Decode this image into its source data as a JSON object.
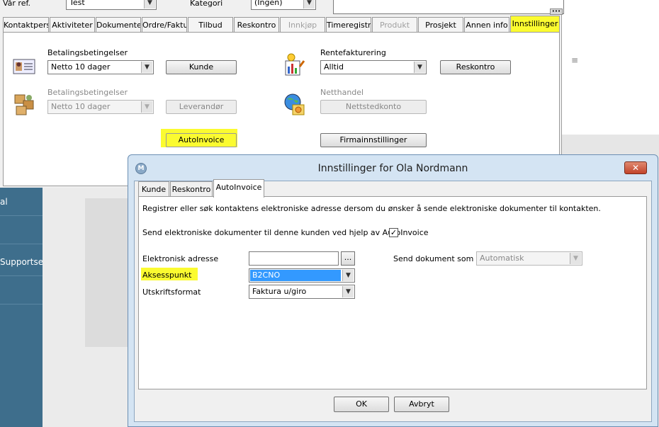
{
  "header": {
    "var_ref_label": "Vår ref.",
    "var_ref_value": "Test",
    "kategori_label": "Kategori",
    "kategori_value": "(Ingen)"
  },
  "tabs": [
    {
      "label": "Kontaktpersοn"
    },
    {
      "label": "Aktiviteter"
    },
    {
      "label": "Dokumenter"
    },
    {
      "label": "Ordre/Faktu"
    },
    {
      "label": "Tilbud"
    },
    {
      "label": "Reskontro"
    },
    {
      "label": "Innkjøp"
    },
    {
      "label": "Timeregistrer"
    },
    {
      "label": "Produkt"
    },
    {
      "label": "Prosjekt"
    },
    {
      "label": "Annen info"
    },
    {
      "label": "Innstillinger"
    }
  ],
  "settings": {
    "kunde_betaling_label": "Betalingsbetingelser",
    "kunde_betaling_value": "Netto 10 dager",
    "kunde_button": "Kunde",
    "lev_betaling_label": "Betalingsbetingelser",
    "lev_betaling_value": "Netto 10 dager",
    "lev_button": "Leverandør",
    "autoinvoice_button": "AutoInvoice",
    "rente_label": "Rentefakturering",
    "rente_value": "Alltid",
    "reskontro_button": "Reskontro",
    "netthandel_label": "Netthandel",
    "nettsted_button": "Nettstedkonto",
    "firma_button": "Firmainnstillinger"
  },
  "sidebar": {
    "items": [
      {
        "label": "al"
      },
      {
        "label": ""
      },
      {
        "label": "Supportsen"
      }
    ]
  },
  "dialog": {
    "title": "Innstillinger for Ola Nordmann",
    "close": "✕",
    "tabs": [
      {
        "label": "Kunde"
      },
      {
        "label": "Reskontro"
      },
      {
        "label": "AutoInvoice"
      }
    ],
    "intro": "Registrer eller søk kontaktens elektroniske adresse dersom du ønsker å sende elektroniske dokumenter til kontakten.",
    "send_label": "Send elektroniske dokumenter til denne kunden ved hjelp av AutoInvoice",
    "send_checked": "✓",
    "elektronisk_label": "Elektronisk adresse",
    "elektronisk_value": "",
    "dots": "...",
    "send_dok_label": "Send dokument som",
    "send_dok_value": "Automatisk",
    "aksesspunkt_label": "Aksesspunkt",
    "aksesspunkt_value": "B2CNO",
    "utskrift_label": "Utskriftsformat",
    "utskrift_value": "Faktura u/giro",
    "ok_button": "OK",
    "avbryt_button": "Avbryt"
  }
}
